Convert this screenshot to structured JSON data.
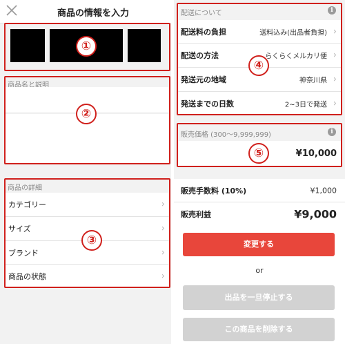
{
  "header": {
    "title": "商品の情報を入力",
    "close_icon": "close-icon"
  },
  "markers": [
    "①",
    "②",
    "③",
    "④",
    "⑤"
  ],
  "name_description": {
    "label": "商品名と説明"
  },
  "details": {
    "label": "商品の詳細",
    "items": [
      {
        "label": "カテゴリー"
      },
      {
        "label": "サイズ"
      },
      {
        "label": "ブランド"
      },
      {
        "label": "商品の状態"
      }
    ]
  },
  "shipping": {
    "label": "配送について",
    "items": [
      {
        "label": "配送料の負担",
        "value": "送料込み(出品者負担)"
      },
      {
        "label": "配送の方法",
        "value": "らくらくメルカリ便"
      },
      {
        "label": "発送元の地域",
        "value": "神奈川県"
      },
      {
        "label": "発送までの日数",
        "value": "2~3日で発送"
      }
    ]
  },
  "price": {
    "label": "販売価格 (300〜9,999,999)",
    "value": "¥10,000"
  },
  "fee": {
    "label": "販売手数料 (10%)",
    "value": "¥1,000"
  },
  "profit": {
    "label": "販売利益",
    "value": "¥9,000"
  },
  "buttons": {
    "change": "変更する",
    "or": "or",
    "pause": "出品を一旦停止する",
    "delete": "この商品を削除する"
  },
  "colors": {
    "accent": "#e8463b",
    "marker": "#d0201c"
  }
}
